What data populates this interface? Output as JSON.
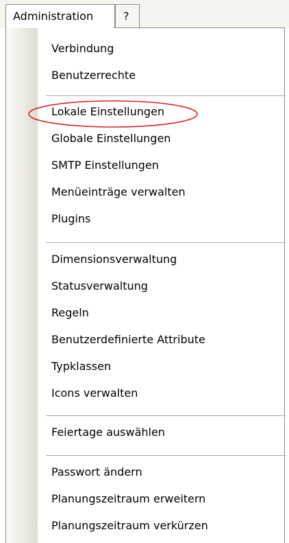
{
  "menubar": {
    "menus": [
      {
        "label": "Administration"
      },
      {
        "label": "?"
      }
    ]
  },
  "dropdown": {
    "items": [
      {
        "label": "Verbindung"
      },
      {
        "label": "Benutzerrechte"
      },
      {
        "label": "Lokale Einstellungen"
      },
      {
        "label": "Globale Einstellungen"
      },
      {
        "label": "SMTP Einstellungen"
      },
      {
        "label": "Menüeinträge verwalten"
      },
      {
        "label": "Plugins"
      },
      {
        "label": "Dimensionsverwaltung"
      },
      {
        "label": "Statusverwaltung"
      },
      {
        "label": "Regeln"
      },
      {
        "label": "Benutzerdefinierte Attribute"
      },
      {
        "label": "Typklassen"
      },
      {
        "label": "Icons verwalten"
      },
      {
        "label": "Feiertage auswählen"
      },
      {
        "label": "Passwort ändern"
      },
      {
        "label": "Planungszeitraum erweitern"
      },
      {
        "label": "Planungszeitraum verkürzen"
      }
    ]
  },
  "annotation": {
    "ellipse_color": "#e02020",
    "highlighted_item": "Lokale Einstellungen"
  }
}
